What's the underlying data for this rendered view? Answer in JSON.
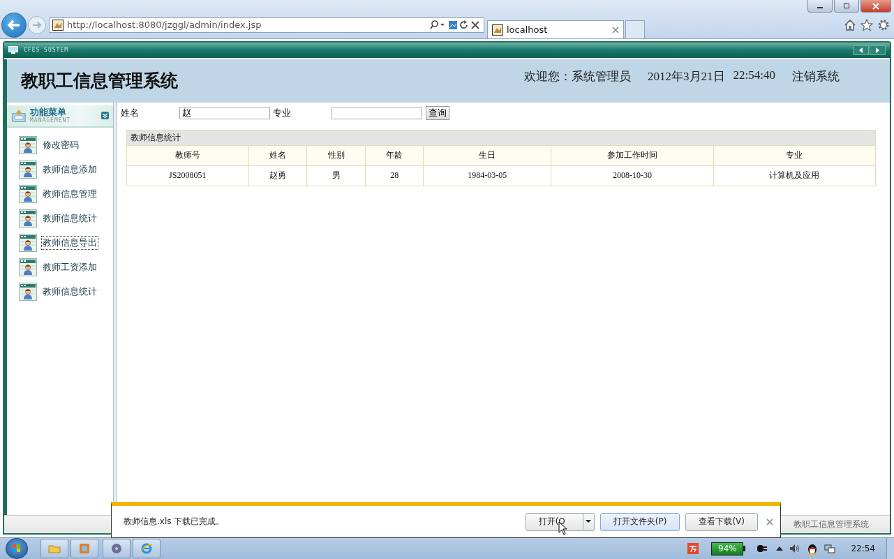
{
  "browser": {
    "address": "http://localhost:8080/jzggl/admin/index.jsp",
    "tabs": [
      {
        "title": "localhost",
        "selected": true
      }
    ]
  },
  "app": {
    "logo_text": "CFES SUSTEM",
    "title": "教职工信息管理系统",
    "welcome": "欢迎您：系统管理员",
    "date": "2012年3月21日",
    "time": "22:54:40",
    "logout": "注销系统"
  },
  "sidebar": {
    "heading": "功能菜单",
    "subheading": "MANAGEMENT",
    "items": [
      {
        "label": "修改密码",
        "selected": false
      },
      {
        "label": "教师信息添加",
        "selected": false
      },
      {
        "label": "教师信息管理",
        "selected": false
      },
      {
        "label": "教师信息统计",
        "selected": false
      },
      {
        "label": "教师信息导出",
        "selected": true
      },
      {
        "label": "教师工资添加",
        "selected": false
      },
      {
        "label": "教师信息统计",
        "selected": false
      }
    ]
  },
  "search": {
    "fields": [
      {
        "label": "姓名",
        "value": "赵"
      },
      {
        "label": "专业"
      }
    ],
    "button": "查询"
  },
  "table": {
    "caption": "教师信息统计",
    "columns": [
      "教师号",
      "姓名",
      "性别",
      "年龄",
      "生日",
      "参加工作时间",
      "专业"
    ],
    "rows": [
      [
        "JS2008051",
        "赵勇",
        "男",
        "28",
        "1984-03-05",
        "2008-10-30",
        "计算机及应用"
      ]
    ]
  },
  "status_bar": {
    "text": "教职工信息管理系统"
  },
  "download_bar": {
    "message": "教师信息.xls 下载已完成。",
    "buttons": [
      {
        "label": "打开(O",
        "kind": "split"
      },
      {
        "label": "打开文件夹(P)",
        "kind": "primary"
      },
      {
        "label": "查看下载(V)",
        "kind": "normal"
      }
    ]
  },
  "taskbar": {
    "battery": "94%",
    "clock": "22:54"
  }
}
